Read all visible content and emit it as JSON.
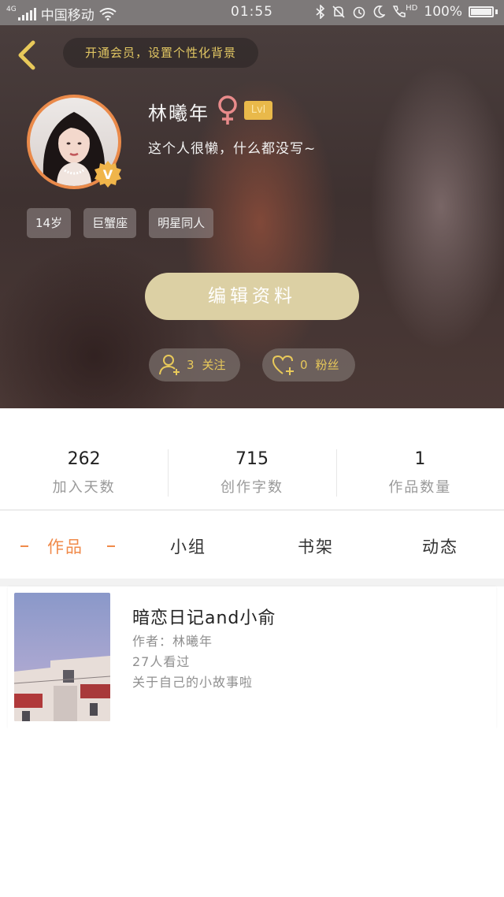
{
  "status_bar": {
    "network": "4G",
    "carrier": "中国移动",
    "time": "01:55",
    "hd": "HD",
    "battery": "100%"
  },
  "header": {
    "vip_banner": "开通会员，设置个性化背景"
  },
  "profile": {
    "username": "林曦年",
    "gender_symbol": "♀",
    "level": "Lvl",
    "bio": "这个人很懒，什么都没写~",
    "verified_badge": "V",
    "tags": [
      "14岁",
      "巨蟹座",
      "明星同人"
    ],
    "edit_button": "编辑资料",
    "following_count": "3",
    "following_label": "关注",
    "followers_count": "0",
    "followers_label": "粉丝"
  },
  "stats": [
    {
      "value": "262",
      "label": "加入天数"
    },
    {
      "value": "715",
      "label": "创作字数"
    },
    {
      "value": "1",
      "label": "作品数量"
    }
  ],
  "tabs": {
    "active": "作品",
    "others": [
      "小组",
      "书架",
      "动态"
    ]
  },
  "works": [
    {
      "title": "暗恋日记and小俞",
      "author": "作者：林曦年",
      "views": "27人看过",
      "summary": "关于自己的小故事啦"
    }
  ],
  "colors": {
    "accent_orange": "#f08a4a",
    "gold_text": "#e8c95a",
    "edit_button_bg": "#dcd0a4",
    "level_badge": "#e9b94a",
    "gender_icon": "#e98b8b"
  },
  "icons": {
    "back": "chevron-left-icon",
    "gender": "female-icon",
    "verified": "verified-v-icon",
    "following": "add-user-icon",
    "followers": "heart-plus-icon"
  }
}
